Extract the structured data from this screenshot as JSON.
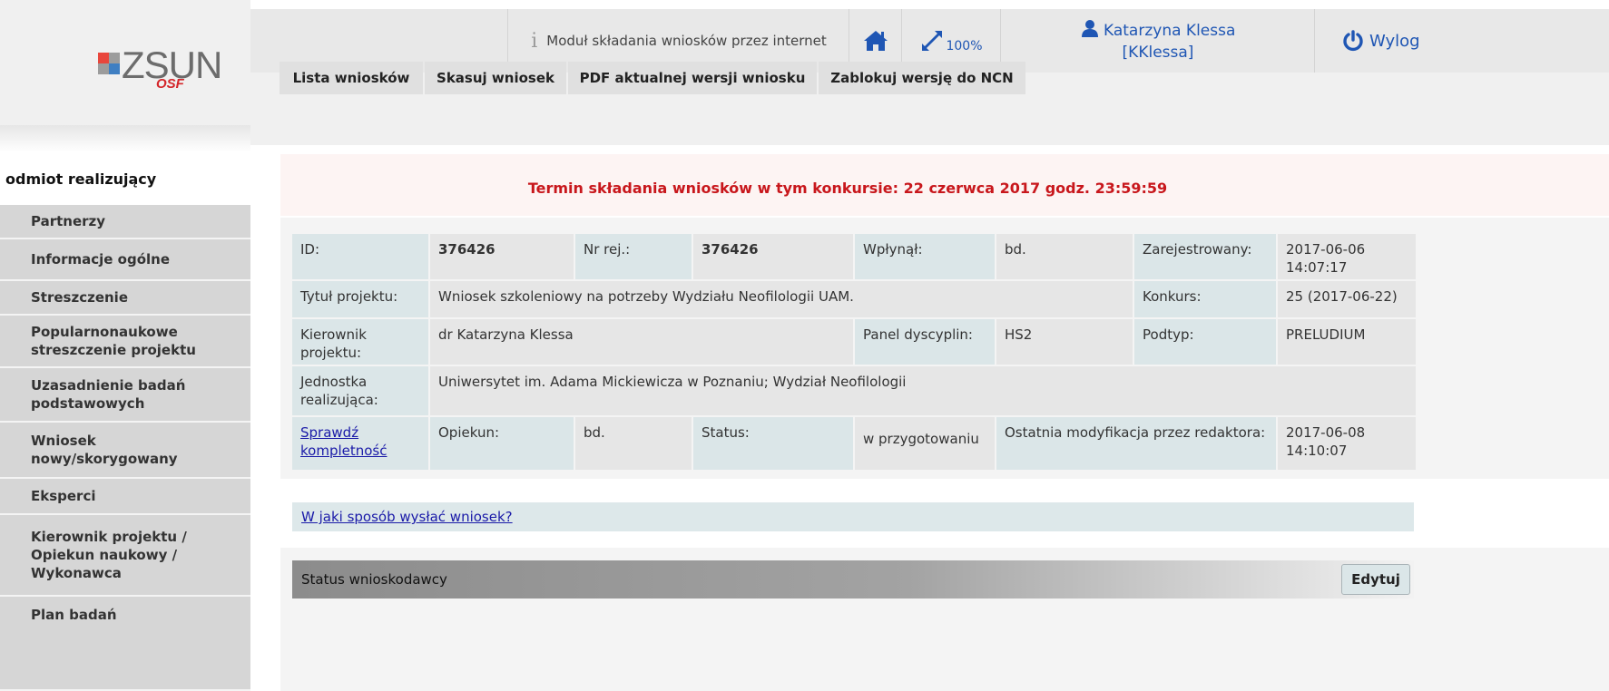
{
  "logo": {
    "word": "ZSUN",
    "sub": "OSF"
  },
  "topbar": {
    "module_label": "Moduł składania wniosków przez internet",
    "zoom": "100%",
    "user_name": "Katarzyna Klessa",
    "user_login": "[KKlessa]",
    "logout_label": "Wylog",
    "icons": [
      "info-icon",
      "home-icon",
      "expand-icon",
      "user-icon",
      "power-icon"
    ]
  },
  "tabs": [
    "Lista wniosków",
    "Skasuj wniosek",
    "PDF aktualnej wersji wniosku",
    "Zablokuj wersję do NCN"
  ],
  "sidebar": {
    "section": "odmiot realizujący",
    "items": [
      "Partnerzy",
      "Informacje ogólne",
      "Streszczenie",
      "Popularnonaukowe\nstreszczenie projektu",
      "Uzasadnienie badań\npodstawowych",
      "Wniosek\nnowy/skorygowany",
      "Eksperci",
      "Kierownik projektu /\nOpiekun naukowy /\nWykonawca",
      "Plan badań"
    ]
  },
  "deadline": "Termin składania wniosków w tym konkursie: 22 czerwca 2017 godz. 23:59:59",
  "info": {
    "id_label": "ID:",
    "id_value": "376426",
    "nrrej_label": "Nr rej.:",
    "nrrej_value": "376426",
    "wplynal_label": "Wpłynął:",
    "wplynal_value": "bd.",
    "zarej_label": "Zarejestrowany:",
    "zarej_value": "2017-06-06\n14:07:17",
    "tytul_label": "Tytuł projektu:",
    "tytul_value": "Wniosek szkoleniowy na potrzeby Wydziału Neofilologii UAM.",
    "konkurs_label": "Konkurs:",
    "konkurs_value": "25 (2017-06-22)",
    "kier_label": "Kierownik\nprojektu:",
    "kier_value": "dr Katarzyna Klessa",
    "panel_label": "Panel dyscyplin:",
    "panel_value": "HS2",
    "podtyp_label": "Podtyp:",
    "podtyp_value": "PRELUDIUM",
    "jedn_label": "Jednostka\nrealizująca:",
    "jedn_value": "Uniwersytet im. Adama Mickiewicza w Poznaniu; Wydział Neofilologii",
    "sprawdz_link": "Sprawdź\nkompletność",
    "opiekun_label": "Opiekun:",
    "opiekun_value": "bd.",
    "status_label": "Status:",
    "status_value": "w przygotowaniu",
    "ostatnia_label": "Ostatnia modyfikacja przez redaktora:",
    "ostatnia_value": "2017-06-08\n14:10:07"
  },
  "how_link": "W jaki sposób wysłać wniosek?",
  "status_section": {
    "title": "Status wnioskodawcy",
    "edit_label": "Edytuj"
  }
}
